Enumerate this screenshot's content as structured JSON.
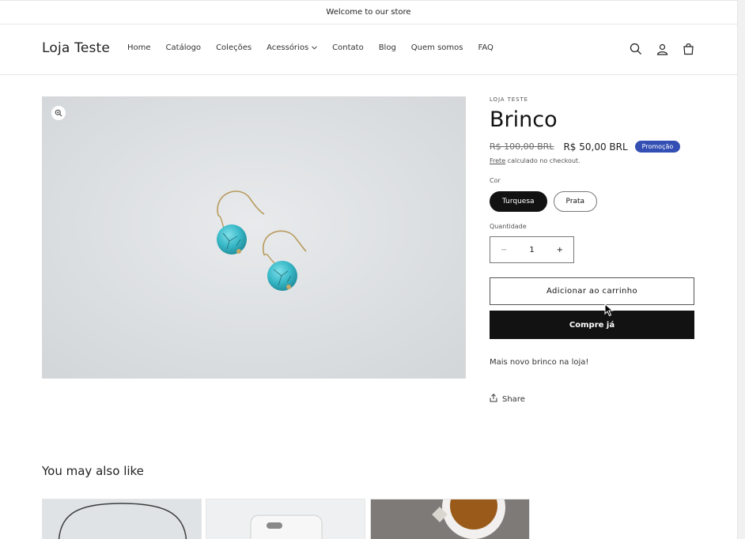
{
  "announcement": "Welcome to our store",
  "header": {
    "logo": "Loja Teste",
    "nav": [
      {
        "label": "Home",
        "dropdown": false
      },
      {
        "label": "Catálogo",
        "dropdown": false
      },
      {
        "label": "Coleções",
        "dropdown": false
      },
      {
        "label": "Acessórios",
        "dropdown": true
      },
      {
        "label": "Contato",
        "dropdown": false
      },
      {
        "label": "Blog",
        "dropdown": false
      },
      {
        "label": "Quem somos",
        "dropdown": false
      },
      {
        "label": "FAQ",
        "dropdown": false
      }
    ],
    "icons": [
      "search-icon",
      "account-icon",
      "cart-icon"
    ]
  },
  "product": {
    "vendor": "LOJA TESTE",
    "title": "Brinco",
    "price_old": "R$ 100,00 BRL",
    "price_new": "R$ 50,00 BRL",
    "badge": "Promoção",
    "shipping_link": "Frete",
    "shipping_text": " calculado no checkout.",
    "color_label": "Cor",
    "colors": [
      {
        "label": "Turquesa",
        "selected": true
      },
      {
        "label": "Prata",
        "selected": false
      }
    ],
    "quantity_label": "Quantidade",
    "quantity": "1",
    "minus": "−",
    "plus": "+",
    "add_to_cart": "Adicionar ao carrinho",
    "buy_now": "Compre já",
    "description": "Mais novo brinco na loja!",
    "share": "Share"
  },
  "related": {
    "title": "You may also like"
  },
  "colors": {
    "badge": "#334fb4",
    "primary": "#121212",
    "turquoise": "#3dbdcc"
  }
}
